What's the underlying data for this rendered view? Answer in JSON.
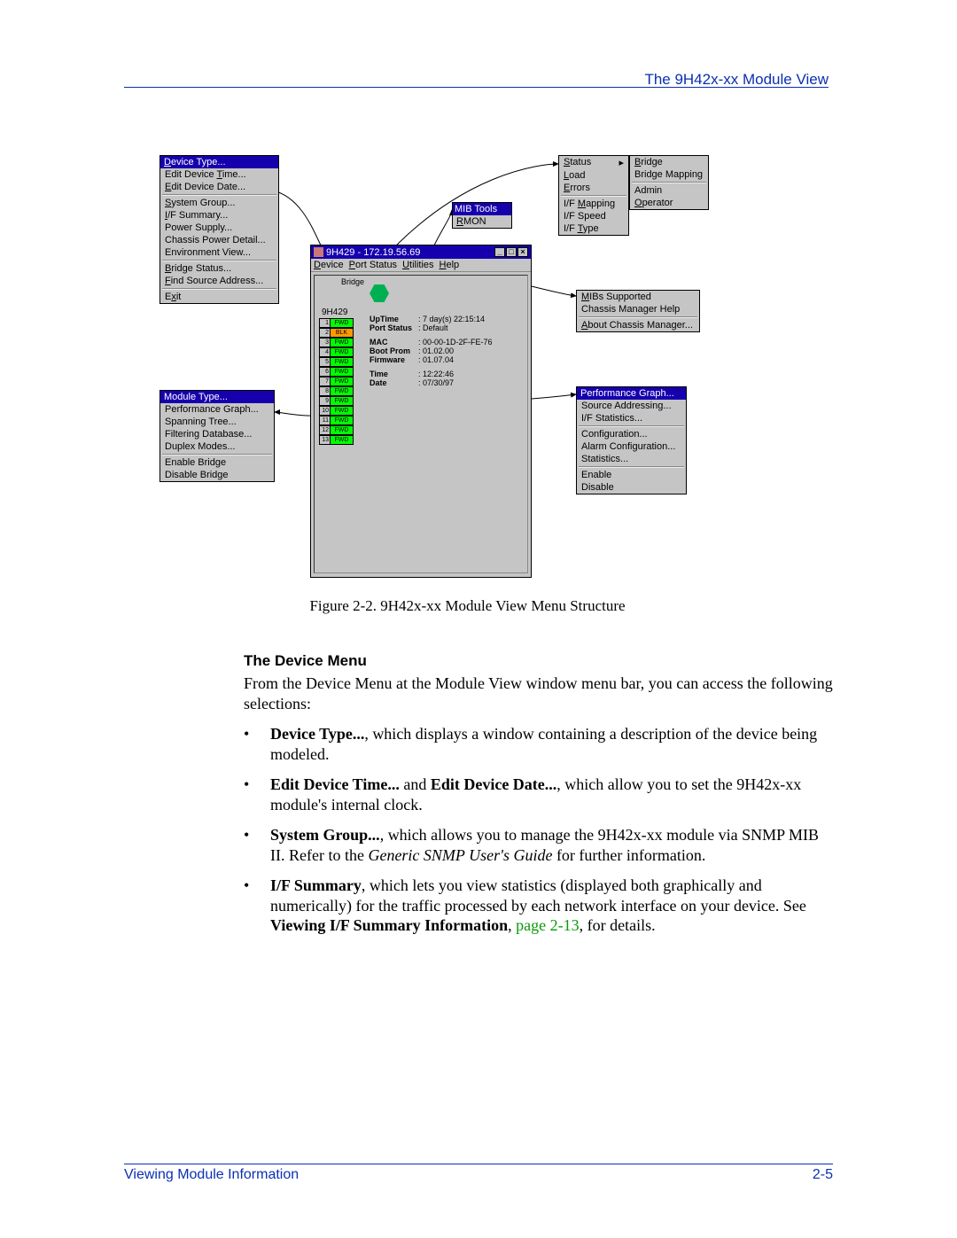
{
  "header": {
    "title": "The 9H42x-xx Module View"
  },
  "figure": {
    "caption": "Figure 2-2.  9H42x-xx Module View Menu Structure",
    "device_menu": {
      "title": "Device Type...",
      "items": [
        {
          "label": "Edit Device Time...",
          "ul": "T"
        },
        {
          "label": "Edit Device Date...",
          "ul": "E"
        },
        {
          "label": "System Group...",
          "ul": "S"
        },
        {
          "label": "I/F Summary...",
          "ul": "I"
        },
        {
          "label": "Power Supply..."
        },
        {
          "label": "Chassis Power Detail..."
        },
        {
          "label": "Environment View..."
        },
        {
          "label": "Bridge Status...",
          "ul": "B"
        },
        {
          "label": "Find Source Address...",
          "ul": "F"
        },
        {
          "label": "Exit",
          "ul": "x"
        }
      ]
    },
    "module_menu": {
      "title": "Module Type...",
      "items": [
        {
          "label": "Performance Graph..."
        },
        {
          "label": "Spanning Tree..."
        },
        {
          "label": "Filtering Database..."
        },
        {
          "label": "Duplex Modes..."
        },
        {
          "label": "Enable Bridge"
        },
        {
          "label": "Disable Bridge"
        }
      ]
    },
    "utils_menu_left": {
      "items": [
        {
          "label": "Status",
          "ul": "S"
        },
        {
          "label": "Load",
          "ul": "L"
        },
        {
          "label": "Errors",
          "ul": "E"
        },
        {
          "label": "I/F Mapping",
          "ul": "M"
        },
        {
          "label": "I/F Speed"
        },
        {
          "label": "I/F Type",
          "ul": "T"
        }
      ]
    },
    "utils_menu_right": {
      "items": [
        {
          "label": "Bridge",
          "ul": "B"
        },
        {
          "label": "Bridge Mapping"
        },
        {
          "label": "Admin"
        },
        {
          "label": "Operator",
          "ul": "O"
        }
      ]
    },
    "help_menu": {
      "items": [
        {
          "label": "MIBs Supported",
          "ul": "M"
        },
        {
          "label": "Chassis Manager Help"
        },
        {
          "label": "About Chassis Manager...",
          "ul": "A"
        }
      ]
    },
    "port_menu": {
      "title": "Performance Graph...",
      "items": [
        {
          "label": "Source Addressing..."
        },
        {
          "label": "I/F Statistics..."
        },
        {
          "label": "Configuration..."
        },
        {
          "label": "Alarm Configuration..."
        },
        {
          "label": "Statistics..."
        },
        {
          "label": "Enable"
        },
        {
          "label": "Disable"
        }
      ]
    },
    "mib_tools": {
      "title": "MIB Tools",
      "row": "RMON"
    },
    "module_window": {
      "title": "9H429 - 172.19.56.69",
      "menubar": [
        "Device",
        "Port Status",
        "Utilities",
        "Help"
      ],
      "bridge_label": "Bridge",
      "module_name": "9H429",
      "ports": [
        {
          "n": "1",
          "s": "FWD",
          "c": "fwd"
        },
        {
          "n": "2",
          "s": "BLK",
          "c": "blk"
        },
        {
          "n": "3",
          "s": "FWD",
          "c": "fwd"
        },
        {
          "n": "4",
          "s": "FWD",
          "c": "fwd"
        },
        {
          "n": "5",
          "s": "FWD",
          "c": "fwd"
        },
        {
          "n": "6",
          "s": "FWD",
          "c": "fwd"
        },
        {
          "n": "7",
          "s": "FWD",
          "c": "fwd"
        },
        {
          "n": "8",
          "s": "FWD",
          "c": "fwd"
        },
        {
          "n": "9",
          "s": "FWD",
          "c": "fwd"
        },
        {
          "n": "10",
          "s": "FWD",
          "c": "fwd"
        },
        {
          "n": "11",
          "s": "FWD",
          "c": "fwd"
        },
        {
          "n": "12",
          "s": "FWD",
          "c": "fwd"
        },
        {
          "n": "13",
          "s": "FWD",
          "c": "fwd"
        }
      ],
      "stats": {
        "UpTime": ": 7 day(s) 22:15:14",
        "PortStatusLabel": "Port Status",
        "PortStatus": ": Default",
        "MAC": ": 00-00-1D-2F-FE-76",
        "BootProm": ": 01.02.00",
        "Firmware": ": 01.07.04",
        "Time": ": 12:22:46",
        "Date": ": 07/30/97"
      }
    }
  },
  "section": {
    "heading": "The Device Menu",
    "intro": "From the Device Menu at the Module View window menu bar, you can access the following selections:",
    "bullets": [
      {
        "parts": [
          "<b>Device Type...</b>, which displays a window containing a description of the device being modeled."
        ]
      },
      {
        "parts": [
          "<b>Edit Device Time...</b> and <b>Edit Device Date...</b>, which allow you to set the 9H42x-xx module's internal clock."
        ]
      },
      {
        "parts": [
          "<b>System Group...</b>, which allows you to manage the 9H42x-xx module via SNMP MIB II. Refer to the <i>Generic SNMP User's Guide</i> for further information."
        ]
      },
      {
        "parts": [
          "<b>I/F Summary</b>, which lets you view statistics (displayed both graphically and numerically) for the traffic processed by each network interface on your device. See <b>Viewing I/F Summary Information</b>, <span class='link-green'>page 2-13</span>, for details."
        ]
      }
    ]
  },
  "footer": {
    "left": "Viewing Module Information",
    "right": "2-5"
  }
}
